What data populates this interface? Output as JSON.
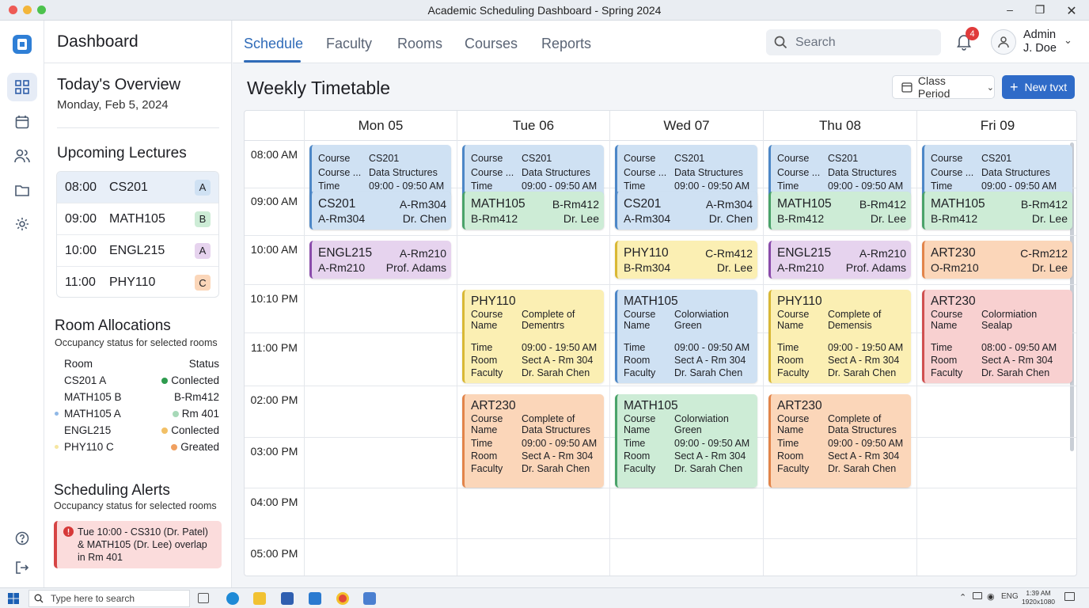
{
  "window": {
    "title": "Academic Scheduling Dashboard - Spring 2024"
  },
  "sidebar": {
    "title": "Dashboard"
  },
  "header": {
    "tabs": [
      "Schedule",
      "Faculty",
      "Rooms",
      "Courses",
      "Reports"
    ],
    "active_tab": "Schedule",
    "search_placeholder": "Search",
    "notification_count": "4",
    "user_name_line1": "Admin",
    "user_name_line2": "J. Doe"
  },
  "overview": {
    "title": "Today's Overview",
    "date": "Monday, Feb 5, 2024"
  },
  "upcoming": {
    "title": "Upcoming Lectures",
    "items": [
      {
        "time": "08:00",
        "course": "CS201",
        "badge": "A",
        "badge_color": "#cfe1f3"
      },
      {
        "time": "09:00",
        "course": "MATH105",
        "badge": "B",
        "badge_color": "#cdecd6"
      },
      {
        "time": "10:00",
        "course": "ENGL215",
        "badge": "A",
        "badge_color": "#e6d3ee"
      },
      {
        "time": "11:00",
        "course": "PHY110",
        "badge": "C",
        "badge_color": "#fbd6b9"
      }
    ]
  },
  "rooms": {
    "title": "Room Allocations",
    "subtitle": "Occupancy status for selected rooms",
    "col_room": "Room",
    "col_status": "Status",
    "rows": [
      {
        "room": "CS201 A",
        "status": "Conlected",
        "dot": "#2e9b4e",
        "room_dot": ""
      },
      {
        "room": "MATH105 B",
        "status": "B-Rm412",
        "dot": "",
        "room_dot": ""
      },
      {
        "room": "MATH105 A",
        "status": "Rm 401",
        "dot": "#a7d9b8",
        "room_dot": "#8fb8e6"
      },
      {
        "room": "ENGL215",
        "status": "Conlected",
        "dot": "#f2c066",
        "room_dot": ""
      },
      {
        "room": "PHY110 C",
        "status": "Greated",
        "dot": "#f0a060",
        "room_dot": "#f6e6a0"
      }
    ]
  },
  "alerts": {
    "title": "Scheduling Alerts",
    "subtitle": "Occupancy status for selected rooms",
    "message": "Tue 10:00 - CS310 (Dr. Patel) & MATH105 (Dr. Lee) overlap in Rm 401"
  },
  "timetable": {
    "title": "Weekly Timetable",
    "period_label": "Class Period",
    "new_label": "New tvxt",
    "days": [
      "Mon 05",
      "Tue 06",
      "Wed 07",
      "Thu 08",
      "Fri 09"
    ],
    "times": [
      "08:00 AM",
      "09:00 AM",
      "10:00 AM",
      "10:10 PM",
      "11:00 PM",
      "02:00 PM",
      "03:00 PM",
      "04:00 PM",
      "05:00 PM"
    ],
    "detail_block": {
      "k1": "Course",
      "v1": "CS201",
      "k2": "Course ...",
      "v2": "Data Structures",
      "k3": "Time",
      "v3": "09:00 - 09:50 AM",
      "k4": "Room",
      "v4": "Sect A - Rm 304",
      "k5": "Faculty",
      "v5": "Dr. Sarah Chen"
    },
    "row10": [
      {
        "a": "CS201",
        "b": "A-Rm304",
        "c": "A-Rm304",
        "d": "Dr. Chen",
        "color": "blue"
      },
      {
        "a": "MATH105",
        "b": "B-Rm412",
        "c": "B-Rm412",
        "d": "Dr. Lee",
        "color": "green"
      },
      {
        "a": "CS201",
        "b": "A-Rm304",
        "c": "A-Rm304",
        "d": "Dr. Chen",
        "color": "blue"
      },
      {
        "a": "MATH105",
        "b": "B-Rm412",
        "c": "B-Rm412",
        "d": "Dr. Lee",
        "color": "green"
      },
      {
        "a": "MATH105",
        "b": "B-Rm412",
        "c": "B-Rm412",
        "d": "Dr. Lee",
        "color": "green"
      }
    ],
    "row1010": [
      {
        "a": "ENGL215",
        "b": "A-Rm210",
        "c": "A-Rm210",
        "d": "Prof. Adams",
        "color": "purple"
      },
      null,
      {
        "a": "PHY110",
        "b": "C-Rm412",
        "c": "B-Rm304",
        "d": "Dr. Lee",
        "color": "yellow"
      },
      {
        "a": "ENGL215",
        "b": "A-Rm210",
        "c": "A-Rm210",
        "d": "Prof. Adams",
        "color": "purple"
      },
      {
        "a": "ART230",
        "b": "C-Rm212",
        "c": "O-Rm210",
        "d": "Dr. Lee",
        "color": "orange"
      }
    ],
    "row11": [
      null,
      {
        "title": "PHY110",
        "name1": "Complete of",
        "name2": "Dementrs",
        "time": "09:00 - 19:50 AM",
        "room": "Sect A - Rm 304",
        "faculty": "Dr. Sarah Chen",
        "color": "yellow"
      },
      {
        "title": "MATH105",
        "name1": "Colorwiation",
        "name2": "Green",
        "time": "09:00 - 09:50 AM",
        "room": "Sect A - Rm 304",
        "faculty": "Dr. Sarah Chen",
        "color": "blue"
      },
      {
        "title": "PHY110",
        "name1": "Complete of",
        "name2": "Demensis",
        "time": "09:00 - 19:50 AM",
        "room": "Sect A - Rm 304",
        "faculty": "Dr. Sarah Chen",
        "color": "yellow"
      },
      {
        "title": "ART230",
        "name1": "Colormiation",
        "name2": "Sealap",
        "time": "08:00 - 09:50 AM",
        "room": "Sect A - Rm 304",
        "faculty": "Dr. Sarah Chen",
        "color": "red"
      }
    ],
    "row3": [
      null,
      {
        "title": "ART230",
        "name1": "Complete of",
        "name2": "Data Structures",
        "time": "09:00 - 09:50 AM",
        "room": "Sect A - Rm 304",
        "faculty": "Dr. Sarah Chen",
        "color": "orange"
      },
      {
        "title": "MATH105",
        "name1": "Colorwiation",
        "name2": "Green",
        "time": "09:00 - 09:50 AM",
        "room": "Sect A - Rm 304",
        "faculty": "Dr. Sarah Chen",
        "color": "green"
      },
      {
        "title": "ART230",
        "name1": "Complete of",
        "name2": "Data Structures",
        "time": "09:00 - 09:50 AM",
        "room": "Sect A - Rm 304",
        "faculty": "Dr. Sarah Chen",
        "color": "orange"
      },
      null
    ],
    "labels": {
      "course": "Course",
      "name": "Name",
      "time": "Time",
      "room": "Room",
      "faculty": "Faculty"
    }
  },
  "taskbar": {
    "search_placeholder": "Type here to search",
    "lang": "ENG",
    "clock_time": "1:39 AM",
    "clock_sub": "1920x1080"
  }
}
